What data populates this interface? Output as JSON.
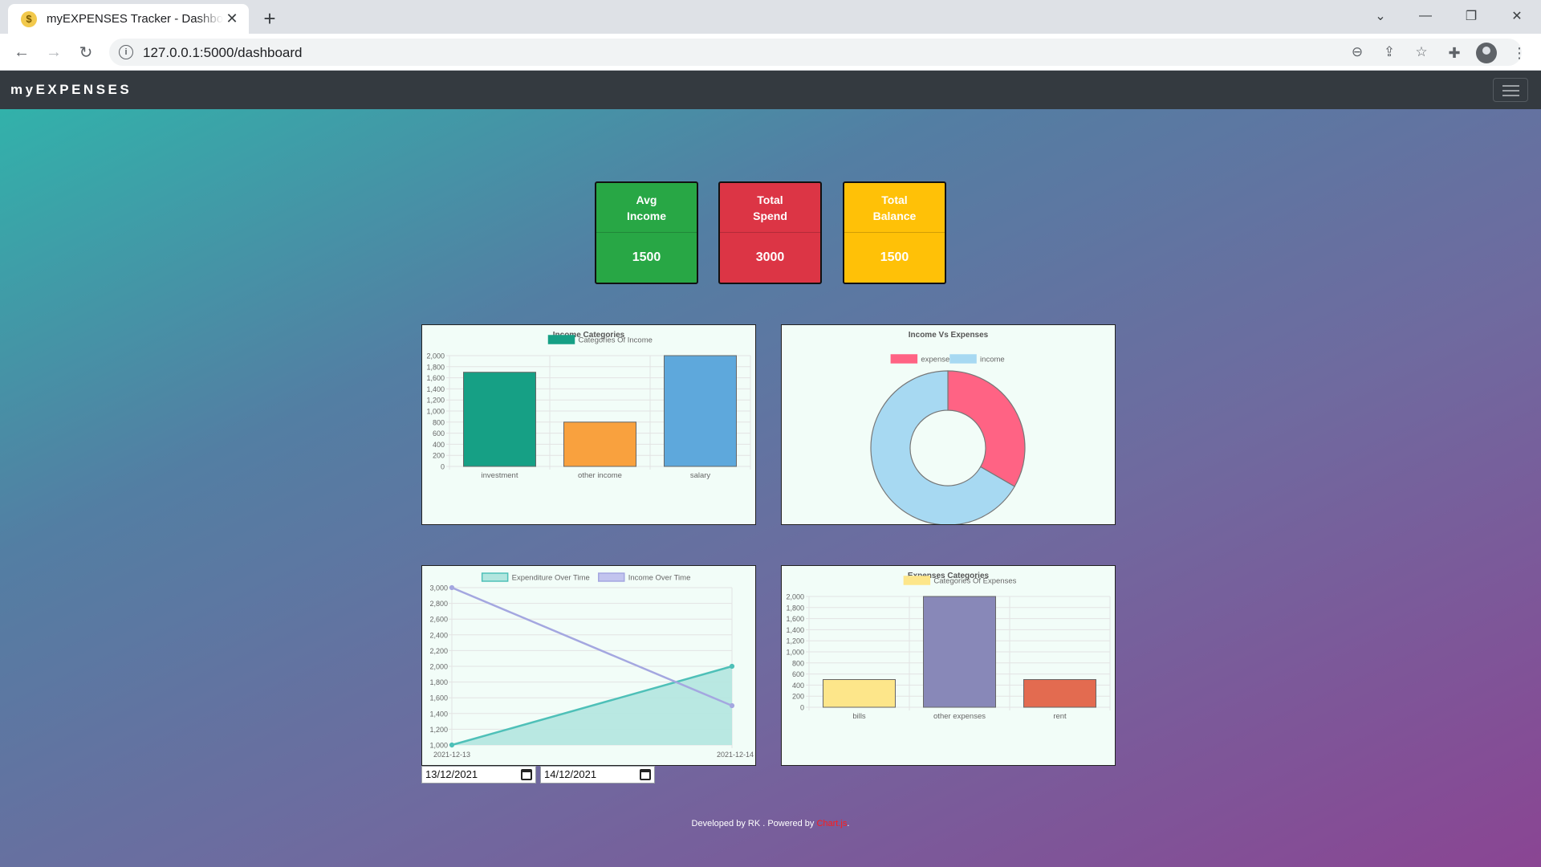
{
  "browser": {
    "tab_title": "myEXPENSES Tracker - Dashboard",
    "url": "127.0.0.1:5000/dashboard"
  },
  "app": {
    "brand": "myEXPENSES",
    "accent": "#343a40"
  },
  "stats": [
    {
      "label": "Avg Income",
      "value": "1500",
      "color": "#28a745"
    },
    {
      "label": "Total Spend",
      "value": "3000",
      "color": "#dc3545"
    },
    {
      "label": "Total Balance",
      "value": "1500",
      "color": "#ffc107"
    }
  ],
  "chart_data": [
    {
      "type": "bar",
      "title": "Income Categories",
      "categories": [
        "investment",
        "other income",
        "salary"
      ],
      "series": [
        {
          "name": "Categories Of Income",
          "values": [
            1700,
            800,
            2000
          ]
        }
      ],
      "colors": [
        "#16a085",
        "#f9a13e",
        "#5ea8dc"
      ],
      "legend_color": "#16a085",
      "ylim": [
        0,
        2000
      ],
      "yticks": [
        "0",
        "200",
        "400",
        "600",
        "800",
        "1,000",
        "1,200",
        "1,400",
        "1,600",
        "1,800",
        "2,000"
      ],
      "legend": "top"
    },
    {
      "type": "pie",
      "title": "Income Vs Expenses",
      "labels": [
        "expense",
        "income"
      ],
      "values": [
        1500,
        3000
      ],
      "colors": [
        "#ff6384",
        "#a7d9f2"
      ],
      "legend": "top"
    },
    {
      "type": "line",
      "title": "",
      "x": [
        "2021-12-13",
        "2021-12-14"
      ],
      "series": [
        {
          "name": "Expenditure Over Time",
          "values": [
            1000,
            2000
          ],
          "color": "#4ec0b8",
          "fill": "#b2e6df"
        },
        {
          "name": "Income Over Time",
          "values": [
            3000,
            1500
          ],
          "color": "#a4a7e0",
          "fill": "#c2c4ee"
        }
      ],
      "ylim": [
        1000,
        3000
      ],
      "yticks": [
        "1,000",
        "1,200",
        "1,400",
        "1,600",
        "1,800",
        "2,000",
        "2,200",
        "2,400",
        "2,600",
        "2,800",
        "3,000"
      ],
      "legend": "top"
    },
    {
      "type": "bar",
      "title": "Expenses Categories",
      "categories": [
        "bills",
        "other expenses",
        "rent"
      ],
      "series": [
        {
          "name": "Categories Of Expenses",
          "values": [
            500,
            2000,
            500
          ]
        }
      ],
      "colors": [
        "#fde68a",
        "#8888b8",
        "#e36b50"
      ],
      "legend_color": "#fde68a",
      "ylim": [
        0,
        2000
      ],
      "yticks": [
        "0",
        "200",
        "400",
        "600",
        "800",
        "1,000",
        "1,200",
        "1,400",
        "1,600",
        "1,800",
        "2,000"
      ],
      "legend": "top"
    }
  ],
  "date_filter": {
    "start": "13/12/2021",
    "end": "14/12/2021"
  },
  "footer": {
    "text": "Developed by RK . Powered by ",
    "link": "Chart.js",
    "suffix": "."
  }
}
